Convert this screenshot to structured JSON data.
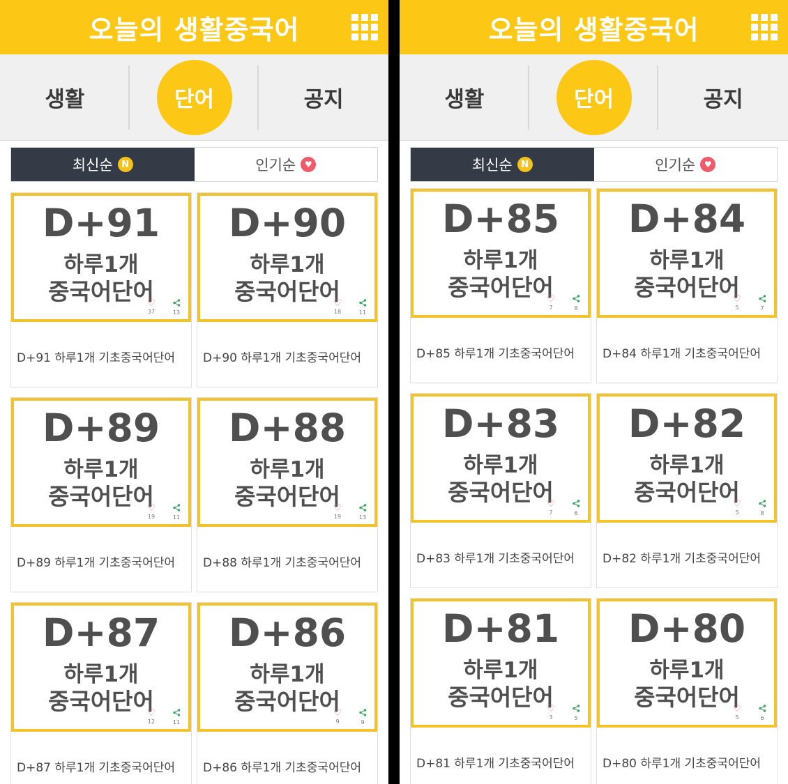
{
  "colors": {
    "accent": "#fdc716",
    "sort_active": "#343a46",
    "card_border": "#f2c32a"
  },
  "screens": [
    {
      "header": {
        "title": "오늘의 생활중국어",
        "menu_icon": "grid-menu-icon"
      },
      "categories": [
        {
          "label": "생활",
          "active": false
        },
        {
          "label": "단어",
          "active": true
        },
        {
          "label": "공지",
          "active": false
        }
      ],
      "sort": {
        "latest": {
          "label": "최신순",
          "badge": "N"
        },
        "popular": {
          "label": "인기순",
          "badge": "♥"
        }
      },
      "posts": [
        {
          "dday": "D+91",
          "line1": "하루1개",
          "line2": "중국어단어",
          "likes": "37",
          "shares": "13",
          "caption": "D+91 하루1개 기초중국어단어"
        },
        {
          "dday": "D+90",
          "line1": "하루1개",
          "line2": "중국어단어",
          "likes": "18",
          "shares": "11",
          "caption": "D+90 하루1개 기초중국어단어"
        },
        {
          "dday": "D+89",
          "line1": "하루1개",
          "line2": "중국어단어",
          "likes": "19",
          "shares": "11",
          "caption": "D+89 하루1개 기초중국어단어"
        },
        {
          "dday": "D+88",
          "line1": "하루1개",
          "line2": "중국어단어",
          "likes": "19",
          "shares": "13",
          "caption": "D+88 하루1개 기초중국어단어"
        },
        {
          "dday": "D+87",
          "line1": "하루1개",
          "line2": "중국어단어",
          "likes": "12",
          "shares": "11",
          "caption": "D+87 하루1개 기초중국어단어"
        },
        {
          "dday": "D+86",
          "line1": "하루1개",
          "line2": "중국어단어",
          "likes": "9",
          "shares": "9",
          "caption": "D+86 하루1개 기초중국어단어"
        }
      ]
    },
    {
      "header": {
        "title": "오늘의 생활중국어",
        "menu_icon": "grid-menu-icon"
      },
      "categories": [
        {
          "label": "생활",
          "active": false
        },
        {
          "label": "단어",
          "active": true
        },
        {
          "label": "공지",
          "active": false
        }
      ],
      "sort": {
        "latest": {
          "label": "최신순",
          "badge": "N"
        },
        "popular": {
          "label": "인기순",
          "badge": "♥"
        }
      },
      "posts": [
        {
          "dday": "D+85",
          "line1": "하루1개",
          "line2": "중국어단어",
          "likes": "7",
          "shares": "8",
          "caption": "D+85 하루1개 기초중국어단어"
        },
        {
          "dday": "D+84",
          "line1": "하루1개",
          "line2": "중국어단어",
          "likes": "5",
          "shares": "7",
          "caption": "D+84 하루1개 기초중국어단어"
        },
        {
          "dday": "D+83",
          "line1": "하루1개",
          "line2": "중국어단어",
          "likes": "7",
          "shares": "6",
          "caption": "D+83 하루1개 기초중국어단어"
        },
        {
          "dday": "D+82",
          "line1": "하루1개",
          "line2": "중국어단어",
          "likes": "5",
          "shares": "8",
          "caption": "D+82 하루1개 기초중국어단어"
        },
        {
          "dday": "D+81",
          "line1": "하루1개",
          "line2": "중국어단어",
          "likes": "3",
          "shares": "5",
          "caption": "D+81 하루1개 기초중국어단어"
        },
        {
          "dday": "D+80",
          "line1": "하루1개",
          "line2": "중국어단어",
          "likes": "5",
          "shares": "6",
          "caption": "D+80 하루1개 기초중국어단어"
        }
      ]
    }
  ]
}
